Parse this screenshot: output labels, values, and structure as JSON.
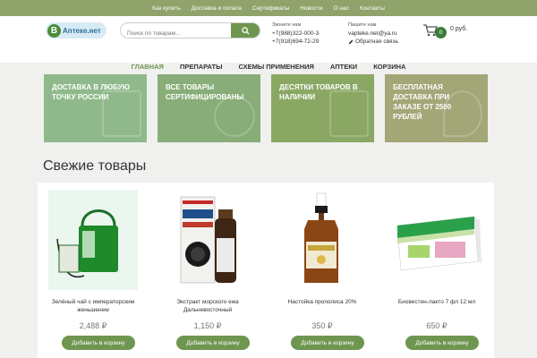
{
  "topbar": {
    "links": [
      "Как купить",
      "Доставка и оплата",
      "Сертификаты",
      "Новости",
      "О нас",
      "Контакты"
    ]
  },
  "logo": {
    "letter": "В",
    "text": "Аптеке.нет"
  },
  "search": {
    "placeholder": "Поиск по товарам..."
  },
  "contacts": {
    "phones_label": "Звоните нам",
    "phone1": "+7(988)322-000-3",
    "phone2": "+7(918)694-72-29",
    "email_label": "Пишите нам",
    "email": "vapteke.net@ya.ru",
    "feedback": "Обратная связь"
  },
  "cart": {
    "count": "0",
    "total": "0 руб."
  },
  "nav": [
    "ГЛАВНАЯ",
    "ПРЕПАРАТЫ",
    "СХЕМЫ ПРИМЕНЕНИЯ",
    "АПТЕКИ",
    "КОРЗИНА"
  ],
  "banners": [
    {
      "text": "ДОСТАВКА В ЛЮБУЮ ТОЧКУ РОССИИ",
      "color": "#8fb98a"
    },
    {
      "text": "ВСЕ ТОВАРЫ СЕРТИФИЦИРОВАНЫ",
      "color": "#88ad78"
    },
    {
      "text": "ДЕСЯТКИ ТОВАРОВ В НАЛИЧИИ",
      "color": "#8aa864"
    },
    {
      "text": "БЕСПЛАТНАЯ ДОСТАВКА ПРИ ЗАКАЗЕ ОТ 2500 РУБЛЕЙ",
      "color": "#a3a677"
    }
  ],
  "section_title": "Свежие товары",
  "products": [
    {
      "name": "Зелёный чай с императорским женьшенем",
      "price": "2,488 ₽",
      "button": "Добавить в корзину"
    },
    {
      "name": "Экстракт морского ежа Дальневосточный",
      "price": "1,150 ₽",
      "button": "Добавить в корзину"
    },
    {
      "name": "Настойка прополиса 20%",
      "price": "350 ₽",
      "button": "Добавить в корзину"
    },
    {
      "name": "Биовестин-лакто 7 фл 12 мл",
      "price": "650 ₽",
      "button": "Добавить в корзину"
    }
  ],
  "icons": {
    "search": "search-icon",
    "cart": "cart-icon",
    "feedback": "pencil-icon"
  }
}
